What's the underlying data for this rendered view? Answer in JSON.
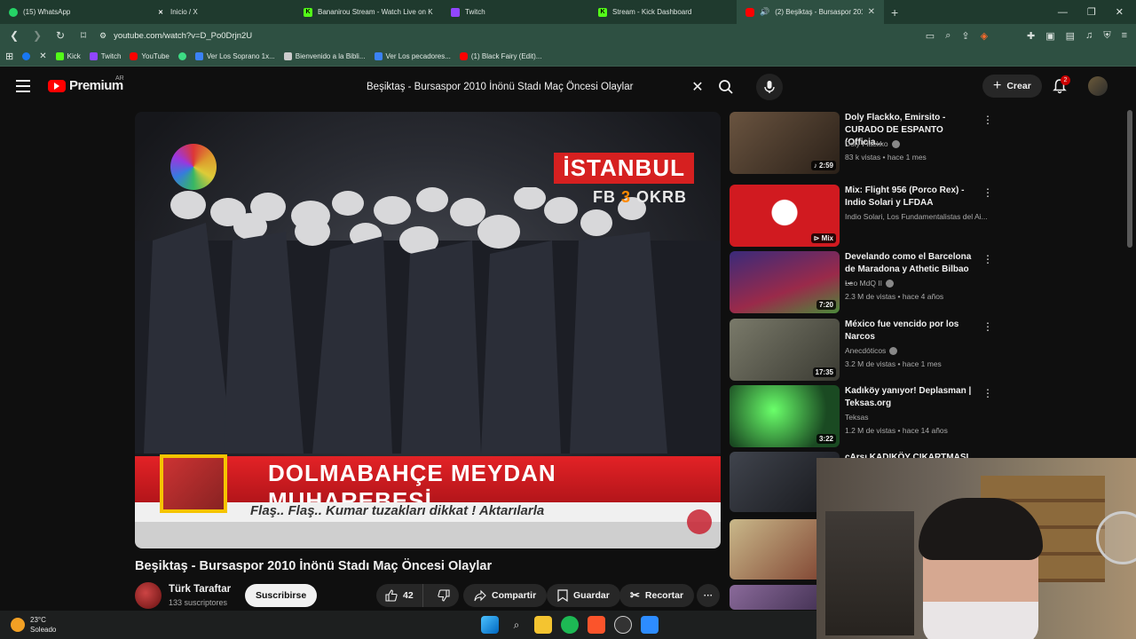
{
  "browser": {
    "tabs": [
      {
        "label": "(15) WhatsApp",
        "icon": "whatsapp-icon",
        "color": "#25d366"
      },
      {
        "label": "Inicio / X",
        "icon": "x-icon",
        "color": "#ffffff"
      },
      {
        "label": "Bananirou Stream - Watch Live on Ki",
        "icon": "kick-icon",
        "color": "#53fc18"
      },
      {
        "label": "Twitch",
        "icon": "twitch-icon",
        "color": "#9146ff"
      },
      {
        "label": "Stream - Kick Dashboard",
        "icon": "kick-icon",
        "color": "#53fc18"
      },
      {
        "label": "(2) Beşiktaş - Bursaspor 2010",
        "icon": "youtube-icon",
        "color": "#ff0000",
        "active": true
      }
    ],
    "url": "youtube.com/watch?v=D_Po0Drjn2U",
    "bookmarks": [
      {
        "label": "",
        "color": "#1877f2"
      },
      {
        "label": "",
        "color": "#ffffff"
      },
      {
        "label": "Kick",
        "color": "#53fc18"
      },
      {
        "label": "Twitch",
        "color": "#9146ff"
      },
      {
        "label": "YouTube",
        "color": "#ff0000"
      },
      {
        "label": "",
        "color": "#3ddc84"
      },
      {
        "label": "Ver Los Soprano 1x...",
        "color": "#3b82f6"
      },
      {
        "label": "Bienvenido a la Bibli...",
        "color": "#cccccc"
      },
      {
        "label": "Ver Los pecadores...",
        "color": "#3b82f6"
      },
      {
        "label": "(1) Black Fairy (Edit)...",
        "color": "#ff0000"
      }
    ]
  },
  "youtube": {
    "logo_text": "Premium",
    "region": "AR",
    "search_query": "Beşiktaş - Bursaspor 2010 İnönü Stadı Maç Öncesi Olaylar",
    "create_label": "Crear",
    "notif_count": "2"
  },
  "video": {
    "overlay_city": "İSTANBUL",
    "overlay_fb": "FB",
    "overlay_fb_mid": "3",
    "overlay_okrb": "OKRB",
    "banner": "DOLMABAHÇE MEYDAN MUHAREBESİ",
    "ticker": "Flaş.. Flaş.. Kumar tuzakları dikkat ! Aktarılarla",
    "title": "Beşiktaş - Bursaspor 2010 İnönü Stadı Maç Öncesi Olaylar",
    "channel": "Türk Taraftar",
    "subs": "133 suscriptores",
    "subscribe": "Suscribirse",
    "likes": "42",
    "share": "Compartir",
    "save": "Guardar",
    "clip": "Recortar"
  },
  "recommendations": [
    {
      "title": "Doly Flackko, Emirsito - CURADO DE ESPANTO (Officia...",
      "channel": "Doly Flackko",
      "verified": true,
      "meta": "83 k vistas • hace 1 mes",
      "duration": "2:59",
      "thumb": "#4a3a2e"
    },
    {
      "title": "Mix: Flight 956 (Porco Rex) - Indio Solari y LFDAA",
      "channel": "Indio Solari, Los Fundamentalistas del Ai...",
      "verified": false,
      "meta": "",
      "duration": "Mix",
      "thumb": "#c8151c"
    },
    {
      "title": "Develando como el Barcelona de Maradona y Athetic Bilbao ...",
      "channel": "Leo MdQ II",
      "verified": true,
      "meta": "2.3 M de vistas • hace 4 años",
      "duration": "7:20",
      "thumb": "#5b3a8a"
    },
    {
      "title": "México fue vencido por los Narcos",
      "channel": "Anecdóticos",
      "verified": true,
      "meta": "3.2 M de vistas • hace 1 mes",
      "duration": "17:35",
      "thumb": "#6a6a5a"
    },
    {
      "title": "Kadıköy yanıyor! Deplasman | Teksas.org",
      "channel": "Teksas",
      "verified": false,
      "meta": "1.2 M de vistas • hace 14 años",
      "duration": "3:22",
      "thumb": "#2f6a3a"
    },
    {
      "title": "çArşı KADIKÖY ÇIKARTMASI",
      "channel": "",
      "verified": false,
      "meta": "",
      "duration": "",
      "thumb": "#2a2d33"
    }
  ],
  "taskbar": {
    "temp": "23°C",
    "weather": "Soleado"
  }
}
